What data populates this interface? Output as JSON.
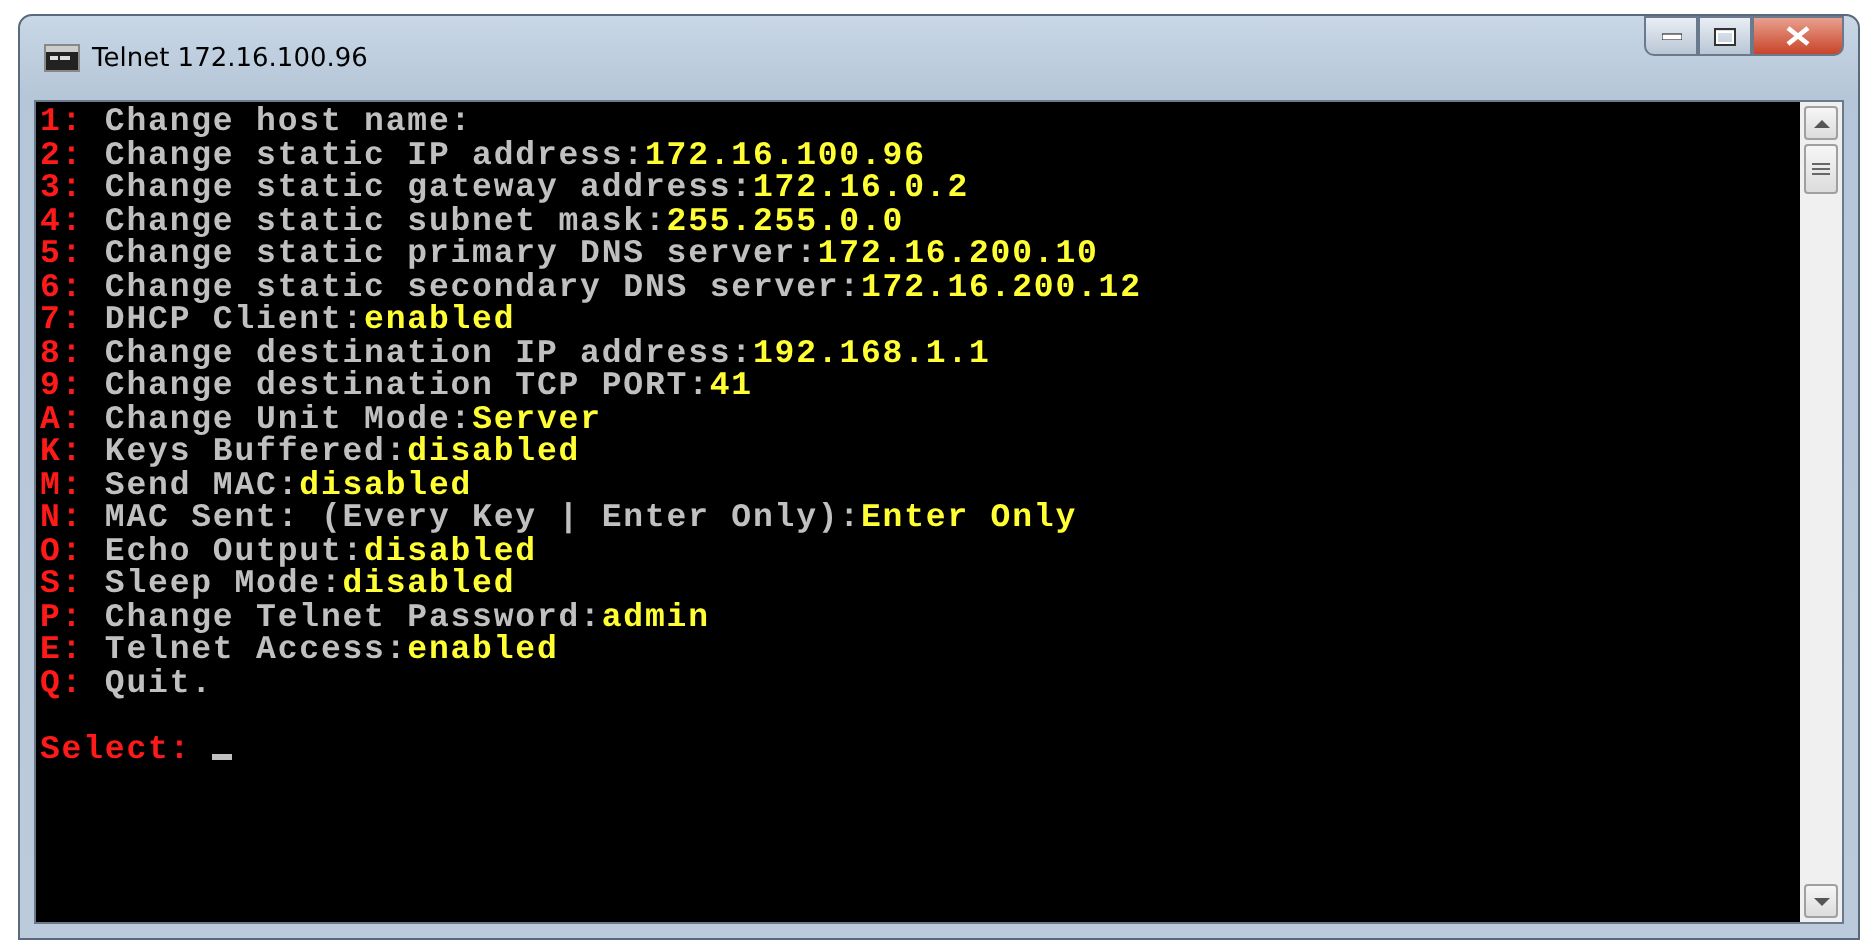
{
  "window": {
    "title": "Telnet 172.16.100.96"
  },
  "lines": [
    {
      "key": "1:",
      "label": "Change host name:"
    },
    {
      "key": "2:",
      "label": "Change static IP address:",
      "value": "172.16.100.96"
    },
    {
      "key": "3:",
      "label": "Change static gateway address:",
      "value": "172.16.0.2"
    },
    {
      "key": "4:",
      "label": "Change static subnet mask:",
      "value": "255.255.0.0"
    },
    {
      "key": "5:",
      "label": "Change static primary DNS server:",
      "value": "172.16.200.10"
    },
    {
      "key": "6:",
      "label": "Change static secondary DNS server:",
      "value": "172.16.200.12"
    },
    {
      "key": "7:",
      "label": "DHCP Client:",
      "value": "enabled"
    },
    {
      "key": "8:",
      "label": "Change destination IP address:",
      "value": "192.168.1.1"
    },
    {
      "key": "9:",
      "label": "Change destination TCP PORT:",
      "value": "41"
    },
    {
      "key": "A:",
      "label": "Change Unit Mode:",
      "value": "Server"
    },
    {
      "key": "K:",
      "label": "Keys Buffered:",
      "value": "disabled"
    },
    {
      "key": "M:",
      "label": "Send MAC:",
      "value": "disabled"
    },
    {
      "key": "N:",
      "label": "MAC Sent: (Every Key | Enter Only):",
      "value": "Enter Only"
    },
    {
      "key": "O:",
      "label": "Echo Output:",
      "value": "disabled"
    },
    {
      "key": "S:",
      "label": "Sleep Mode:",
      "value": "disabled"
    },
    {
      "key": "P:",
      "label": "Change Telnet Password:",
      "value": "admin"
    },
    {
      "key": "E:",
      "label": "Telnet Access:",
      "value": "enabled"
    },
    {
      "key": "Q:",
      "label": "Quit."
    }
  ],
  "prompt": "Select:"
}
